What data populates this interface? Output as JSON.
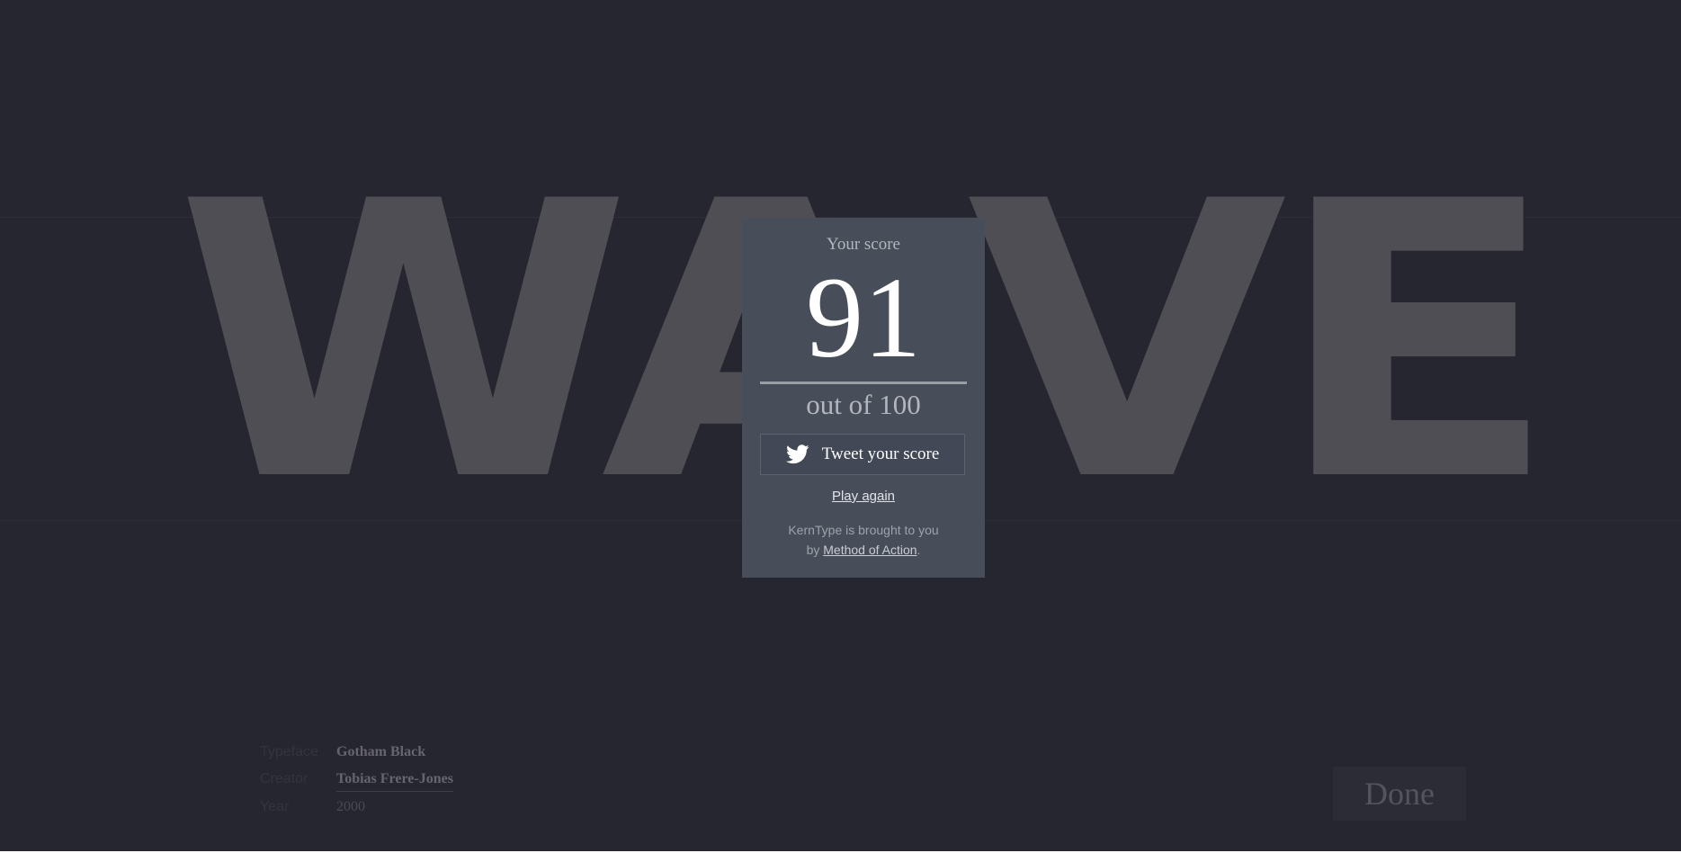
{
  "word": {
    "letters": [
      "W",
      "A",
      "V",
      "E"
    ],
    "color": "#4f4e55"
  },
  "score_card": {
    "label": "Your score",
    "score": "91",
    "out_of": "out of 100",
    "tweet_label": "Tweet your score",
    "tweet_icon": "twitter-bird-icon",
    "play_again": "Play again",
    "credit_line1": "KernType is brought to you",
    "credit_by": "by ",
    "credit_link": "Method of Action",
    "credit_end": "."
  },
  "meta": {
    "typeface_label": "Typeface",
    "typeface_value": "Gotham Black",
    "creator_label": "Creator",
    "creator_value": "Tobias Frere-Jones",
    "year_label": "Year",
    "year_value": "2000"
  },
  "done_label": "Done",
  "colors": {
    "background": "#262630",
    "card": "#474d59",
    "accent_text": "#ffffff"
  }
}
